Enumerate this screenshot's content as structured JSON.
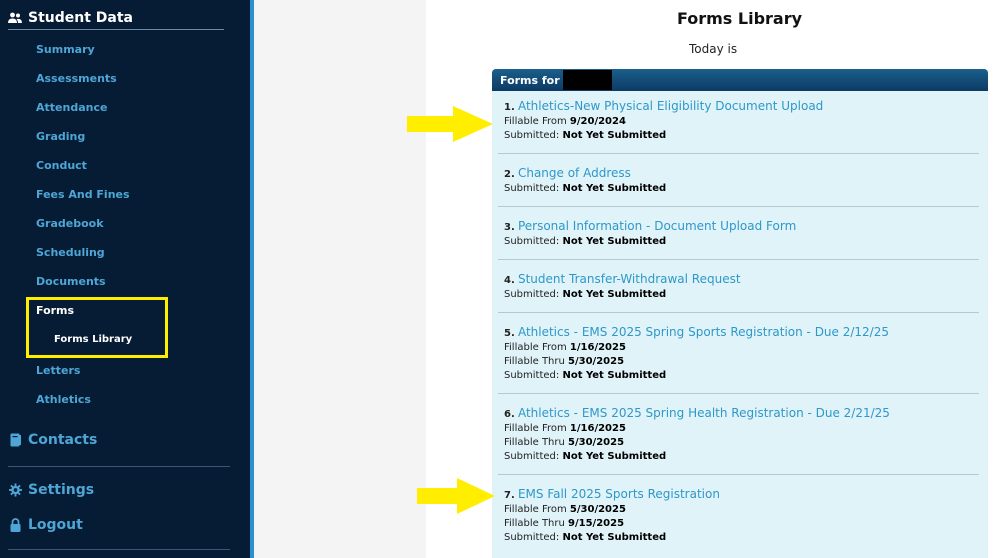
{
  "sidebar": {
    "header": "Student Data",
    "nav": [
      "Summary",
      "Assessments",
      "Attendance",
      "Grading",
      "Conduct",
      "Fees And Fines",
      "Gradebook",
      "Scheduling",
      "Documents"
    ],
    "forms": "Forms",
    "forms_library": "Forms Library",
    "nav_after": [
      "Letters",
      "Athletics"
    ],
    "contacts": "Contacts",
    "settings": "Settings",
    "logout": "Logout"
  },
  "main": {
    "title": "Forms Library",
    "today": "Today is",
    "panel_title": "Forms for",
    "forms": [
      {
        "num": "1.",
        "title": "Athletics-New Physical Eligibility Document Upload",
        "from": "9/20/2024",
        "submitted": "Not Yet Submitted"
      },
      {
        "num": "2.",
        "title": "Change of Address",
        "submitted": "Not Yet Submitted"
      },
      {
        "num": "3.",
        "title": "Personal Information - Document Upload Form",
        "submitted": "Not Yet Submitted"
      },
      {
        "num": "4.",
        "title": "Student Transfer-Withdrawal Request",
        "submitted": "Not Yet Submitted"
      },
      {
        "num": "5.",
        "title": "Athletics - EMS 2025 Spring Sports Registration - Due 2/12/25",
        "from": "1/16/2025",
        "thru": "5/30/2025",
        "submitted": "Not Yet Submitted"
      },
      {
        "num": "6.",
        "title": "Athletics - EMS 2025 Spring Health Registration - Due 2/21/25",
        "from": "1/16/2025",
        "thru": "5/30/2025",
        "submitted": "Not Yet Submitted"
      },
      {
        "num": "7.",
        "title": "EMS Fall 2025 Sports Registration",
        "from": "5/30/2025",
        "thru": "9/15/2025",
        "submitted": "Not Yet Submitted"
      }
    ],
    "labels": {
      "fillable_from": "Fillable From",
      "fillable_thru": "Fillable Thru",
      "submitted": "Submitted:"
    }
  },
  "colors": {
    "sidebar_bg": "#061c34",
    "link": "#2e98c8",
    "panel_bg": "#e0f3f9",
    "highlight": "#ffee00"
  }
}
